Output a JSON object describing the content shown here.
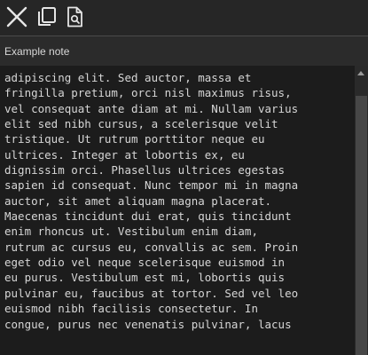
{
  "toolbar": {
    "buttons": [
      {
        "icon": "close-icon"
      },
      {
        "icon": "copy-icon"
      },
      {
        "icon": "find-in-document-icon"
      }
    ]
  },
  "note": {
    "title": "Example note",
    "lines": [
      "adipiscing elit. Sed auctor, massa et",
      "fringilla pretium, orci nisl maximus risus,",
      "vel consequat ante diam at mi. Nullam varius",
      "elit sed nibh cursus, a scelerisque velit",
      "tristique. Ut rutrum porttitor neque eu",
      "ultrices. Integer at lobortis ex, eu",
      "dignissim orci. Phasellus ultrices egestas",
      "sapien id consequat. Nunc tempor mi in magna",
      "auctor, sit amet aliquam magna placerat.",
      "Maecenas tincidunt dui erat, quis tincidunt",
      "enim rhoncus ut. Vestibulum enim diam,",
      "rutrum ac cursus eu, convallis ac sem. Proin",
      "eget odio vel neque scelerisque euismod in",
      "eu purus. Vestibulum est mi, lobortis quis",
      "pulvinar eu, faucibus at tortor. Sed vel leo",
      "euismod nibh facilisis consectetur. In",
      "congue, purus nec venenatis pulvinar, lacus"
    ]
  },
  "colors": {
    "background": "#262626",
    "editor_background": "#1c1c1c",
    "text": "#d6d6d6",
    "icon": "#e6e6e6"
  }
}
